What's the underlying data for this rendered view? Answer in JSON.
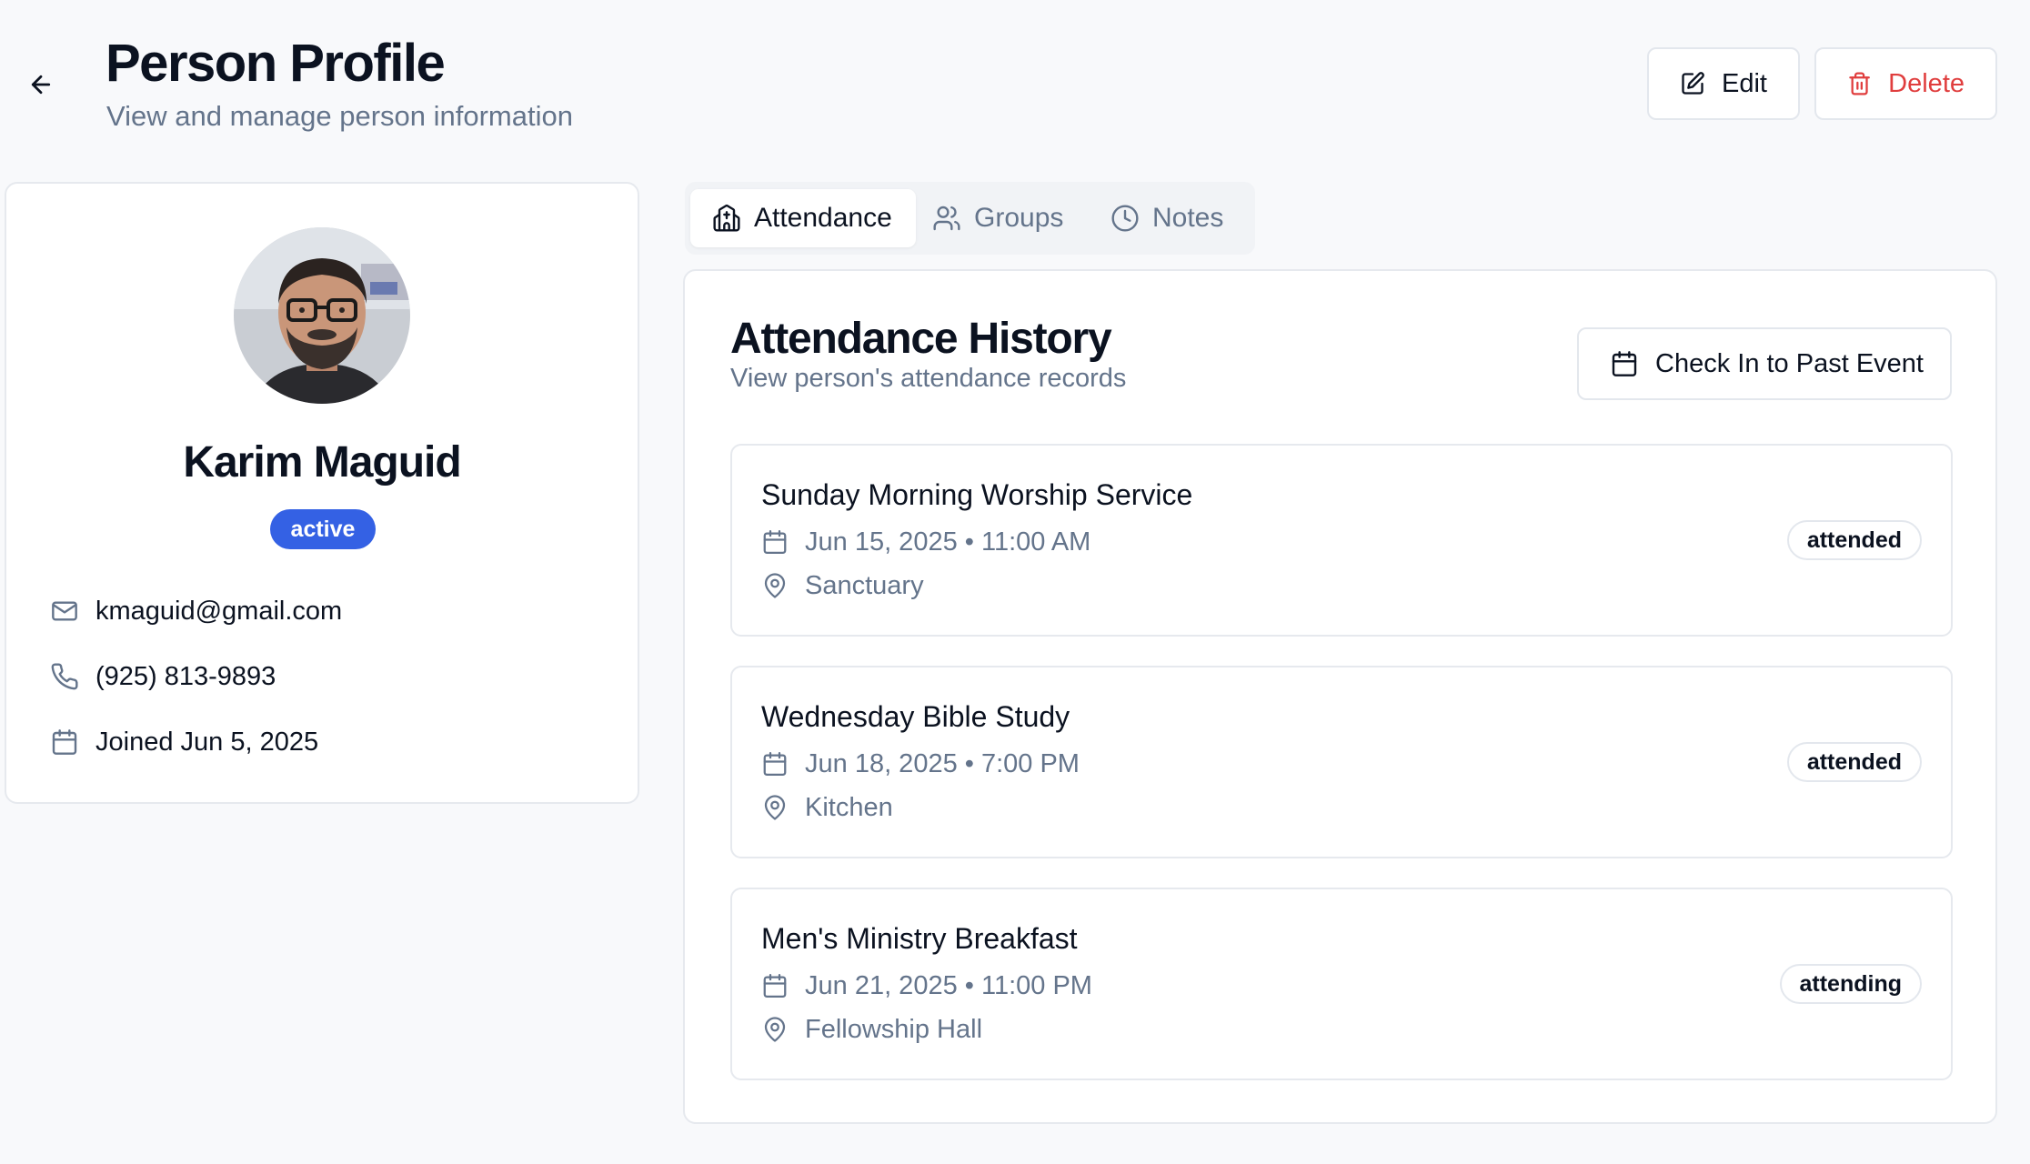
{
  "header": {
    "title": "Person Profile",
    "subtitle": "View and manage person information",
    "edit_label": "Edit",
    "delete_label": "Delete"
  },
  "profile": {
    "name": "Karim Maguid",
    "status": "active",
    "email": "kmaguid@gmail.com",
    "phone": "(925) 813-9893",
    "joined": "Joined Jun 5, 2025"
  },
  "tabs": [
    {
      "label": "Attendance",
      "icon": "church-icon",
      "active": true
    },
    {
      "label": "Groups",
      "icon": "users-icon",
      "active": false
    },
    {
      "label": "Notes",
      "icon": "clock-icon",
      "active": false
    }
  ],
  "attendance": {
    "title": "Attendance History",
    "subtitle": "View person's attendance records",
    "checkin_label": "Check In to Past Event",
    "events": [
      {
        "name": "Sunday Morning Worship Service",
        "datetime": "Jun 15, 2025 • 11:00 AM",
        "location": "Sanctuary",
        "status": "attended"
      },
      {
        "name": "Wednesday Bible Study",
        "datetime": "Jun 18, 2025 • 7:00 PM",
        "location": "Kitchen",
        "status": "attended"
      },
      {
        "name": "Men's Ministry Breakfast",
        "datetime": "Jun 21, 2025 • 11:00 PM",
        "location": "Fellowship Hall",
        "status": "attending"
      }
    ]
  },
  "colors": {
    "accent": "#3461e4",
    "danger": "#e03e3e",
    "muted_text": "#64748b",
    "border": "#e6e9ee",
    "background": "#f8f9fb"
  }
}
